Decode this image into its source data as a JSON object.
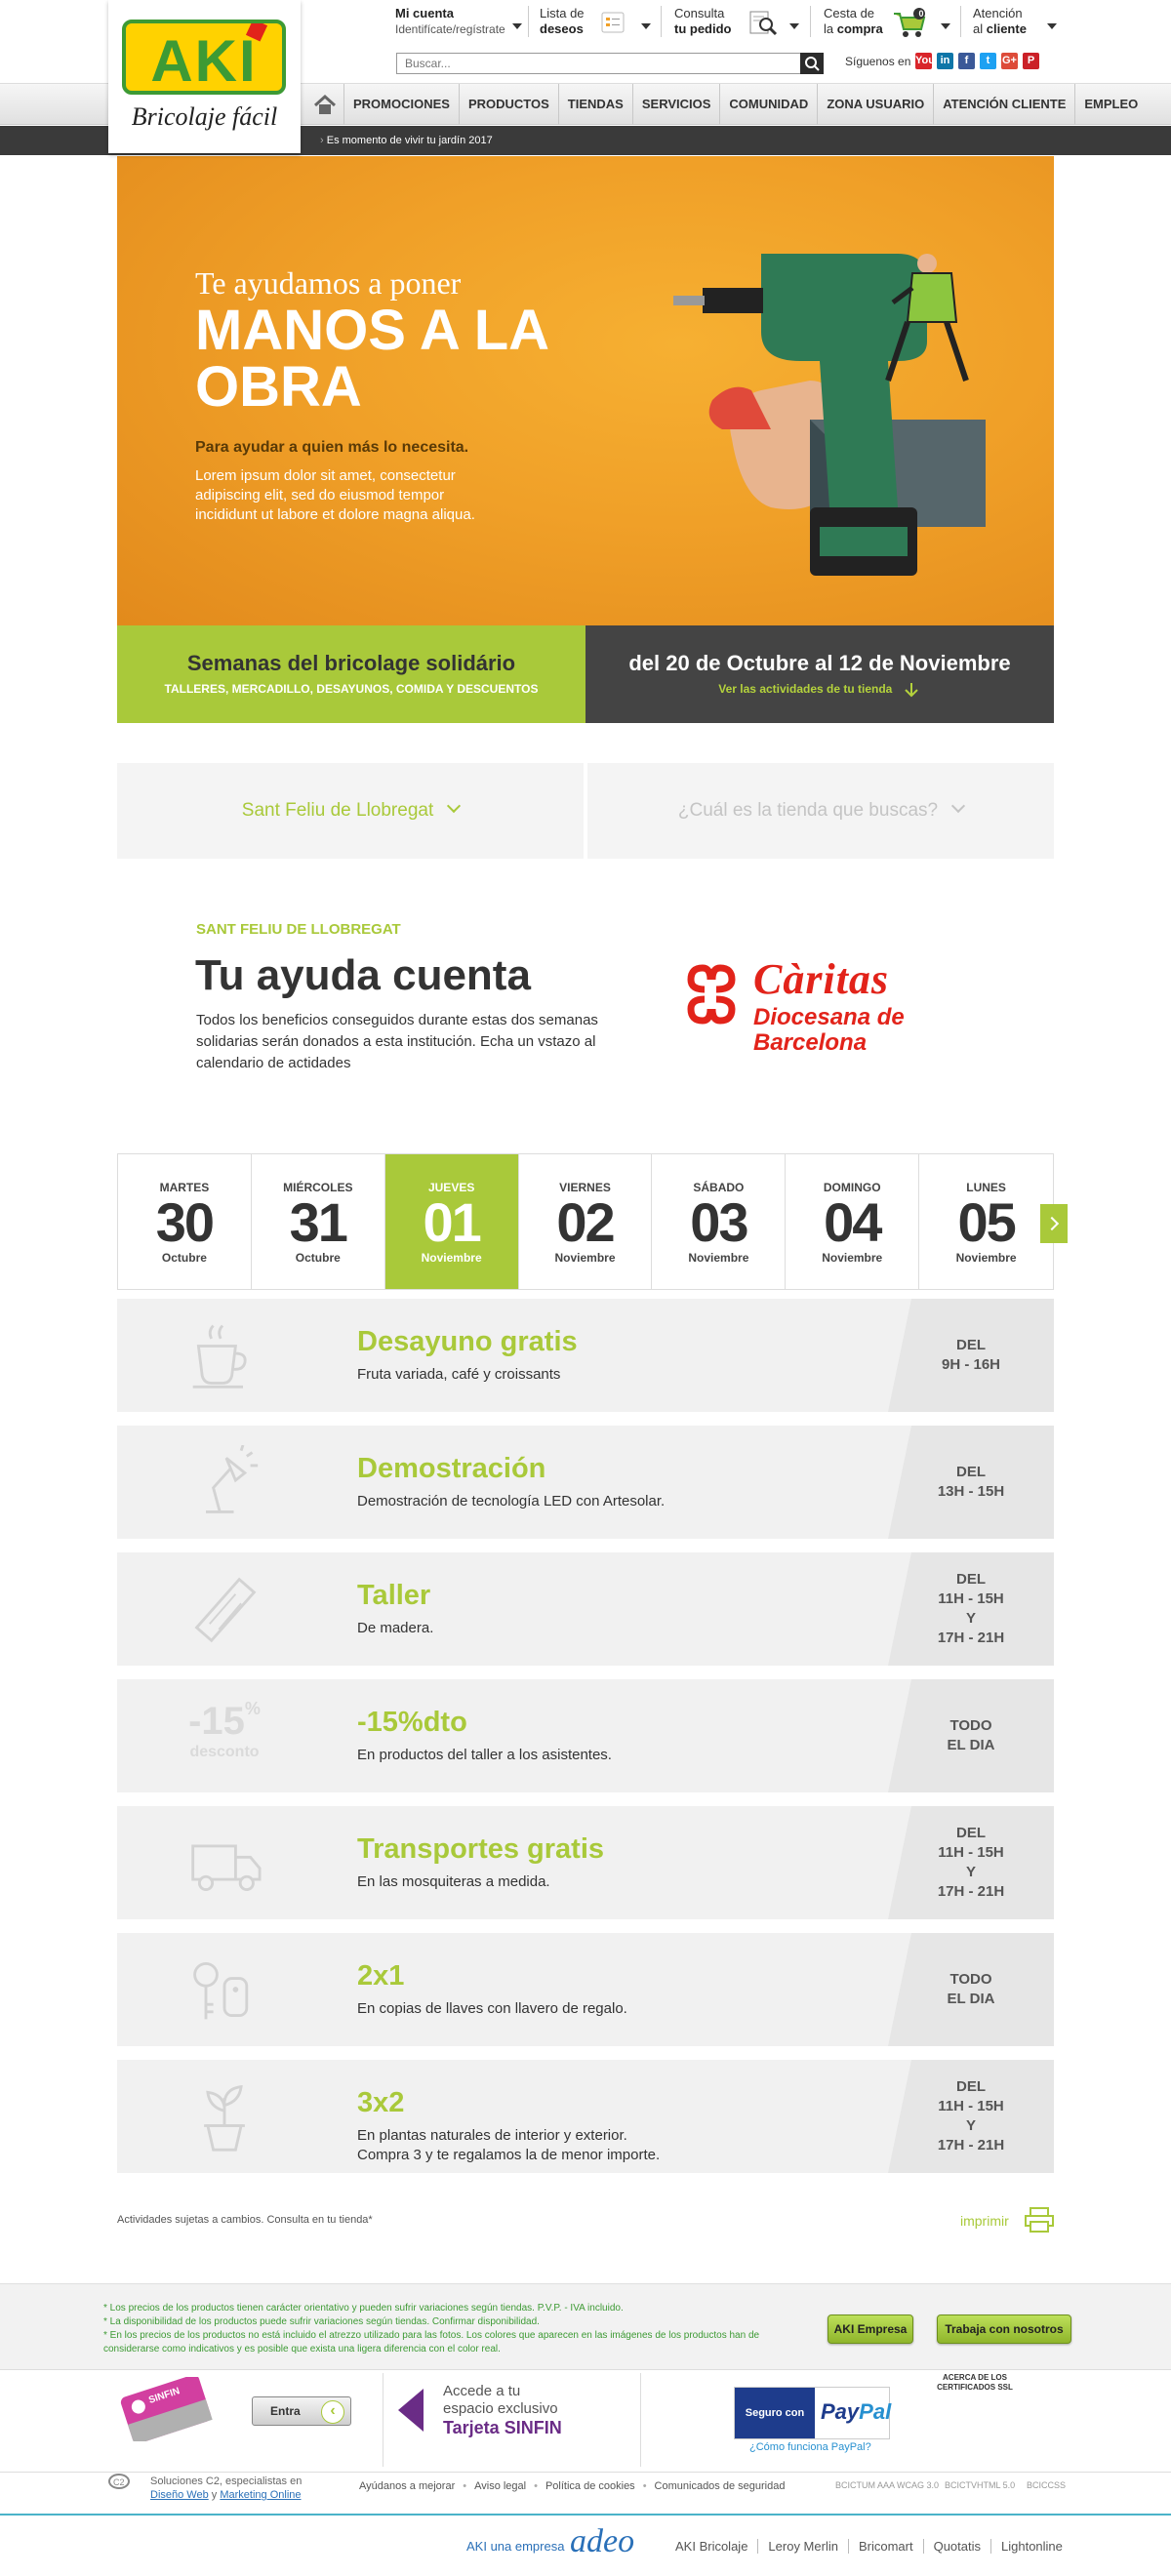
{
  "header": {
    "logo_text": "AKI",
    "logo_tagline": "Bricolaje fácil",
    "account_title": "Mi cuenta",
    "account_sub": "Identifícate/regístrate",
    "wishlist_l1": "Lista de",
    "wishlist_l2": "deseos",
    "order_l1": "Consulta",
    "order_l2": "tu pedido",
    "cart_l1": "Cesta de",
    "cart_l2a": "la ",
    "cart_l2b": "compra",
    "cart_count": "0",
    "support_l1": "Atención",
    "support_l2a": "al ",
    "support_l2b": "cliente",
    "search_placeholder": "Buscar...",
    "follow_label": "Síguenos en",
    "social": [
      "You",
      "in",
      "f",
      "t",
      "G+",
      "P"
    ],
    "social_colors": [
      "#d9252a",
      "#0e76a8",
      "#3b5998",
      "#1da1f2",
      "#dd4b39",
      "#cb2027"
    ]
  },
  "nav": {
    "items": [
      "PROMOCIONES",
      "PRODUCTOS",
      "TIENDAS",
      "SERVICIOS",
      "COMUNIDAD",
      "ZONA USUARIO",
      "ATENCIÓN CLIENTE",
      "EMPLEO"
    ],
    "breadcrumb": "Es momento de vivir tu jardín 2017"
  },
  "hero": {
    "subtitle": "Te ayudamos a poner",
    "title": "MANOS A LA OBRA",
    "lead": "Para ayudar a quien más lo necesita.",
    "body": "Lorem ipsum dolor sit amet, consectetur adipiscing elit, sed do eiusmod tempor incididunt ut labore et dolore magna aliqua.",
    "band_left_title": "Semanas del bricolage solidário",
    "band_left_sub": "TALLERES, MERCADILLO, DESAYUNOS, COMIDA Y DESCUENTOS",
    "band_right_title": "del 20  de Octubre al 12 de Noviembre",
    "band_right_link": "Ver las actividades de tu tienda"
  },
  "store": {
    "selected": "Sant Feliu de Llobregat",
    "placeholder": "¿Cuál es la tienda que buscas?"
  },
  "charity": {
    "kicker": "SANT FELIU DE LLOBREGAT",
    "title": "Tu ayuda cuenta",
    "body": "Todos los beneficios conseguidos durante estas dos semanas solidarias serán donados a esta institución. Echa un vstazo al calendario de actidades",
    "org_name": "Càritas",
    "org_sub1": "Diocesana de",
    "org_sub2": "Barcelona"
  },
  "days": [
    {
      "name": "MARTES",
      "num": "30",
      "month": "Octubre"
    },
    {
      "name": "MIÉRCOLES",
      "num": "31",
      "month": "Octubre"
    },
    {
      "name": "JUEVES",
      "num": "01",
      "month": "Noviembre"
    },
    {
      "name": "VIERNES",
      "num": "02",
      "month": "Noviembre"
    },
    {
      "name": "SÁBADO",
      "num": "03",
      "month": "Noviembre"
    },
    {
      "name": "DOMINGO",
      "num": "04",
      "month": "Noviembre"
    },
    {
      "name": "LUNES",
      "num": "05",
      "month": "Noviembre"
    }
  ],
  "activities": [
    {
      "icon": "coffee-cup-icon",
      "title": "Desayuno gratis",
      "desc": "Fruta variada, café y croissants",
      "time": [
        "DEL",
        "9H - 16H"
      ]
    },
    {
      "icon": "desk-lamp-icon",
      "title": "Demostración",
      "desc": "Demostración de tecnología LED con Artesolar.",
      "time": [
        "DEL",
        "13H - 15H"
      ]
    },
    {
      "icon": "wood-plank-icon",
      "title": "Taller",
      "desc": "De madera.",
      "time": [
        "DEL",
        "11H - 15H",
        "Y",
        "17H - 21H"
      ]
    },
    {
      "icon": "discount-icon",
      "title": "-15%dto",
      "desc": "En productos del taller a los asistentes.",
      "time": [
        "TODO",
        "EL DIA"
      ],
      "icon_text": "-15",
      "icon_pct": "%",
      "icon_sub": "desconto"
    },
    {
      "icon": "delivery-truck-icon",
      "title": "Transportes gratis",
      "desc": "En las mosquiteras a medida.",
      "time": [
        "DEL",
        "11H - 15H",
        "Y",
        "17H - 21H"
      ]
    },
    {
      "icon": "keys-icon",
      "title": "2x1",
      "desc": "En copias de llaves con llavero de regalo.",
      "time": [
        "TODO",
        "EL DIA"
      ]
    },
    {
      "icon": "potted-plant-icon",
      "title": "3x2",
      "desc": "En plantas naturales de interior y exterior.\nCompra 3 y te regalamos la de menor importe.",
      "time": [
        "DEL",
        "11H - 15H",
        "Y",
        "17H - 21H"
      ]
    }
  ],
  "notes": {
    "disclaimer": "Actividades sujetas a cambios. Consulta en tu tienda*",
    "print": "imprimir"
  },
  "footer": {
    "legal": [
      "* Los precios de los productos tienen carácter orientativo y pueden sufrir variaciones según tiendas. P.V.P. - IVA incluido.",
      "* La disponibilidad de los productos puede sufrir variaciones según tiendas. Confirmar disponibilidad.",
      "* En los precios de los productos no está incluido el atrezzo utilizado para las fotos. Los colores que aparecen en las imágenes de los productos han de considerarse como indicativos y es posible que exista una ligera diferencia con el color real."
    ],
    "btn_company": "AKI Empresa",
    "btn_jobs": "Trabaja con nosotros",
    "card_text": "SINFIN",
    "entra": "Entra",
    "sinfin_l1": "Accede a tu",
    "sinfin_l2": "espacio exclusivo",
    "sinfin_l3": "Tarjeta SINFIN",
    "paypal_left": "Seguro con",
    "paypal_a": "Pay",
    "paypal_b": "Pal",
    "paypal_q": "¿Cómo funciona PayPal?",
    "ssl": "ACERCA DE LOS CERTIFICADOS SSL",
    "c2_l1": "Soluciones C2, especialistas en",
    "c2_web": "Diseño Web",
    "c2_y": " y ",
    "c2_mkt": "Marketing Online",
    "links": [
      "Ayúdanos a mejorar",
      "Aviso legal",
      "Política de cookies",
      "Comunicados de seguridad"
    ],
    "iso": [
      "BCICTUM AAA WCAG 3.0",
      "BCICTVHTML 5.0",
      "BCICCSS"
    ],
    "adeo_text": "AKI una empresa",
    "adeo_logo": "adeo",
    "brands": [
      "AKI Bricolaje",
      "Leroy Merlin",
      "Bricomart",
      "Quotatis",
      "Lightonline"
    ]
  }
}
